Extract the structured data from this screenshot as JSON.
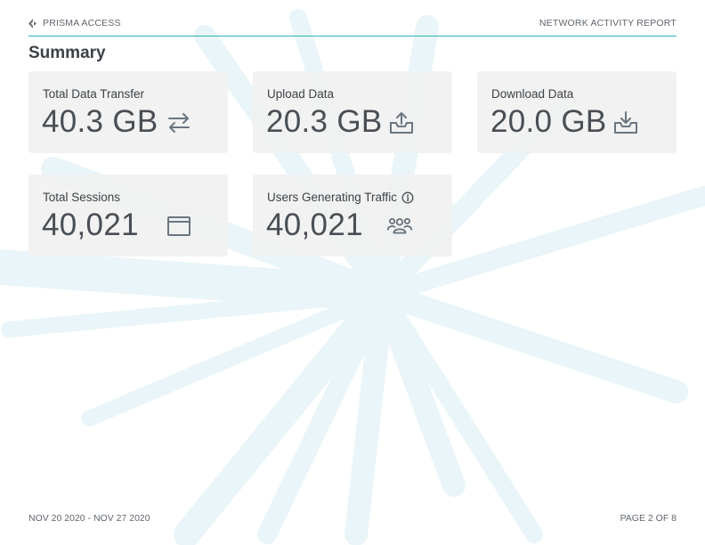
{
  "header": {
    "brand": "PRISMA ACCESS",
    "report_title": "NETWORK ACTIVITY REPORT"
  },
  "section_title": "Summary",
  "cards": [
    {
      "label": "Total Data Transfer",
      "value": "40.3 GB",
      "icon": "transfer-arrows-icon"
    },
    {
      "label": "Upload Data",
      "value": "20.3 GB",
      "icon": "upload-tray-icon"
    },
    {
      "label": "Download Data",
      "value": "20.0 GB",
      "icon": "download-tray-icon"
    },
    {
      "label": "Total Sessions",
      "value": "40,021",
      "icon": "browser-window-icon"
    },
    {
      "label": "Users Generating Traffic",
      "value": "40,021",
      "icon": "users-group-icon",
      "has_info": true
    }
  ],
  "footer": {
    "date_range": "NOV 20 2020 - NOV 27 2020",
    "page": "PAGE 2 OF 8"
  },
  "colors": {
    "accent_rule": "#2ab3b8",
    "card_bg": "#f0f1f0",
    "icon": "#6b7580",
    "text": "#4a4f55",
    "background_rays": "#e8f4f7"
  }
}
